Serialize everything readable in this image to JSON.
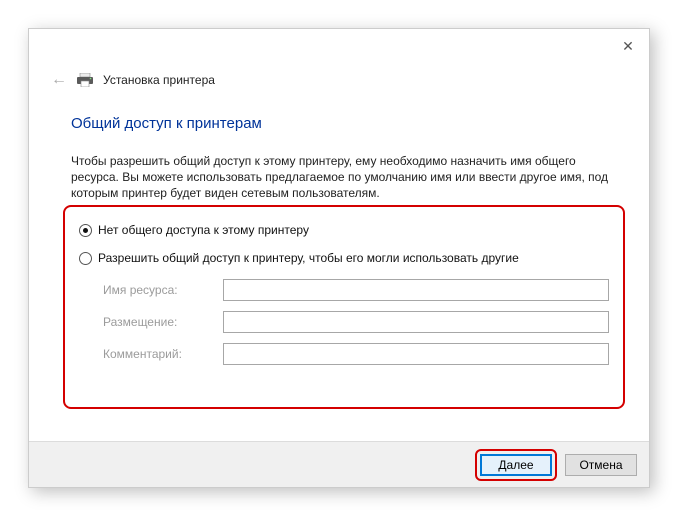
{
  "header": {
    "window_title": "Установка принтера"
  },
  "main": {
    "title": "Общий доступ к принтерам",
    "description": "Чтобы разрешить общий доступ к этому принтеру, ему необходимо назначить имя общего ресурса. Вы можете использовать предлагаемое по умолчанию имя или ввести другое имя, под которым принтер будет виден сетевым пользователям."
  },
  "options": {
    "no_share_label": "Нет общего доступа к этому принтеру",
    "share_label": "Разрешить общий доступ к принтеру, чтобы его могли использовать другие",
    "selected": "no_share"
  },
  "fields": {
    "share_name": {
      "label": "Имя ресурса:",
      "value": ""
    },
    "location": {
      "label": "Размещение:",
      "value": ""
    },
    "comment": {
      "label": "Комментарий:",
      "value": ""
    }
  },
  "buttons": {
    "next": "Далее",
    "cancel": "Отмена"
  },
  "colors": {
    "title_blue": "#003399",
    "highlight_red": "#d40000",
    "primary_border": "#0078d7"
  }
}
